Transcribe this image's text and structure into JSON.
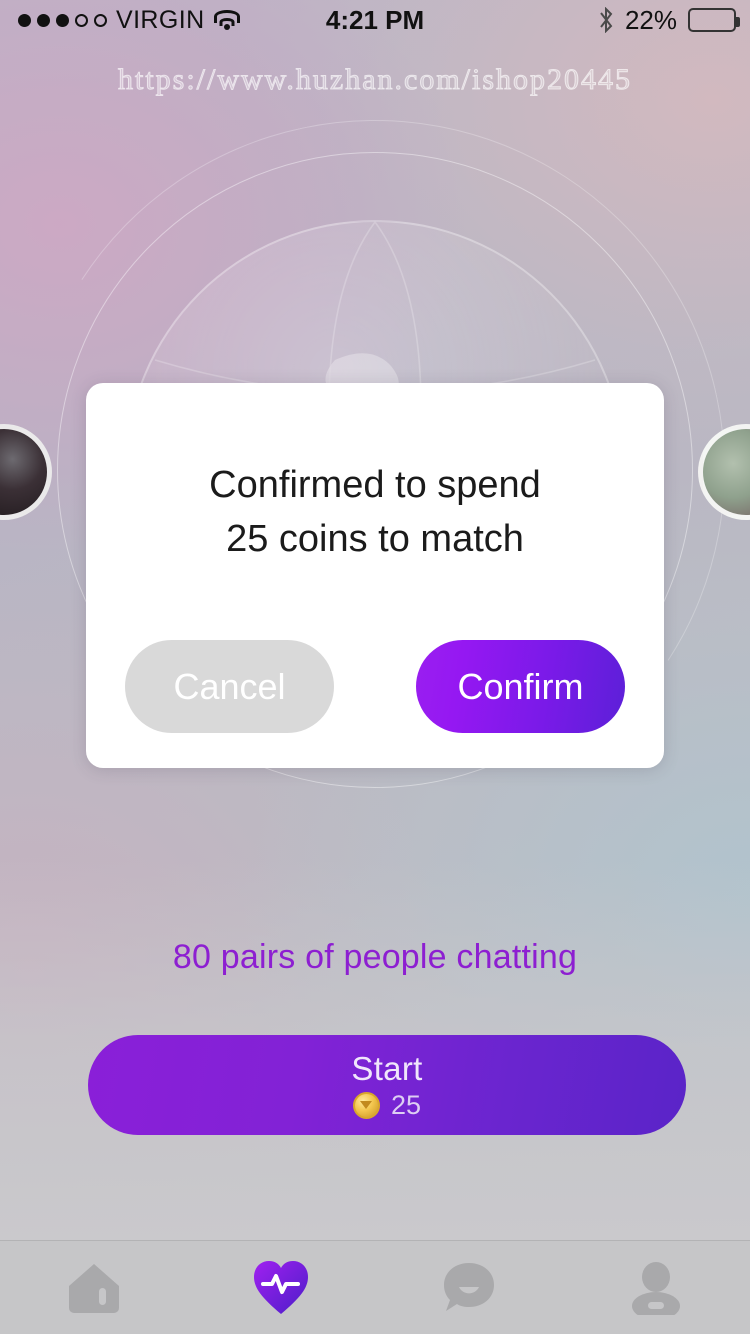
{
  "status_bar": {
    "signal_dots_filled": 3,
    "signal_dots_total": 5,
    "carrier": "VIRGIN",
    "wifi_icon": "wifi-icon",
    "time": "4:21 PM",
    "bluetooth_icon": "bluetooth-icon",
    "battery_percent_label": "22%",
    "battery_level": 22
  },
  "watermark": {
    "url": "https://www.huzhan.com/ishop20445"
  },
  "background": {
    "globe_icon": "globe-icon",
    "avatar_left": "avatar-left",
    "avatar_right": "avatar-right"
  },
  "dialog": {
    "message_line1": "Confirmed to spend",
    "message_line2": "25 coins to match",
    "cancel_label": "Cancel",
    "confirm_label": "Confirm",
    "cancel_color": "#d9d9d9",
    "confirm_color_start": "#9a1ff0",
    "confirm_color_end": "#5c20d8"
  },
  "main": {
    "chat_count_text": "80 pairs of people chatting",
    "chat_count_color": "#8d1fd1",
    "start_label": "Start",
    "start_cost": "25",
    "coin_icon": "coin-icon",
    "start_color_start": "#8a1fd8",
    "start_color_end": "#5a24c8"
  },
  "tabbar": {
    "active_index": 1,
    "active_color": "#8a1fd8",
    "inactive_color": "#a9a9ab",
    "items": [
      {
        "name": "home",
        "icon": "home-icon"
      },
      {
        "name": "match",
        "icon": "heart-pulse-icon"
      },
      {
        "name": "chat",
        "icon": "chat-bubble-icon"
      },
      {
        "name": "profile",
        "icon": "person-icon"
      }
    ]
  }
}
